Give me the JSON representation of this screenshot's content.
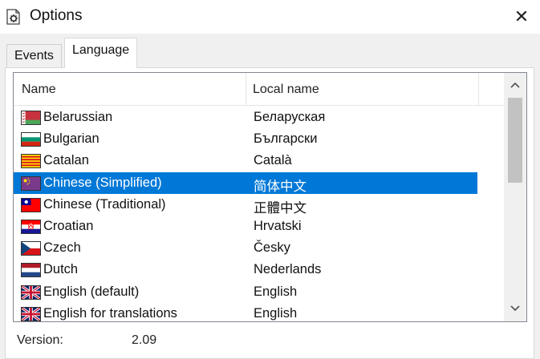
{
  "window": {
    "title": "Options",
    "close_symbol": "✕"
  },
  "tabs": [
    {
      "label": "Events",
      "active": false
    },
    {
      "label": "Language",
      "active": true
    }
  ],
  "list": {
    "columns": {
      "name": "Name",
      "local": "Local name"
    },
    "rows": [
      {
        "name": "Belarussian",
        "local": "Беларуская",
        "flag": "belarus-flag-icon"
      },
      {
        "name": "Bulgarian",
        "local": "Български",
        "flag": "bulgaria-flag-icon"
      },
      {
        "name": "Catalan",
        "local": "Català",
        "flag": "catalonia-flag-icon"
      },
      {
        "name": "Chinese (Simplified)",
        "local": "简体中文",
        "flag": "china-flag-icon",
        "selected": true
      },
      {
        "name": "Chinese (Traditional)",
        "local": "正體中文",
        "flag": "taiwan-flag-icon"
      },
      {
        "name": "Croatian",
        "local": "Hrvatski",
        "flag": "croatia-flag-icon"
      },
      {
        "name": "Czech",
        "local": "Česky",
        "flag": "czech-flag-icon"
      },
      {
        "name": "Dutch",
        "local": "Nederlands",
        "flag": "netherlands-flag-icon"
      },
      {
        "name": "English (default)",
        "local": "English",
        "flag": "uk-flag-icon"
      },
      {
        "name": "English for translations",
        "local": "English",
        "flag": "uk-flag-icon"
      }
    ],
    "scroll": {
      "up_symbol": "^",
      "down_symbol": "v"
    }
  },
  "version": {
    "label": "Version:",
    "value": "2.09"
  },
  "colors": {
    "selection": "#0078d7",
    "window_bg": "#f0f0f0"
  }
}
